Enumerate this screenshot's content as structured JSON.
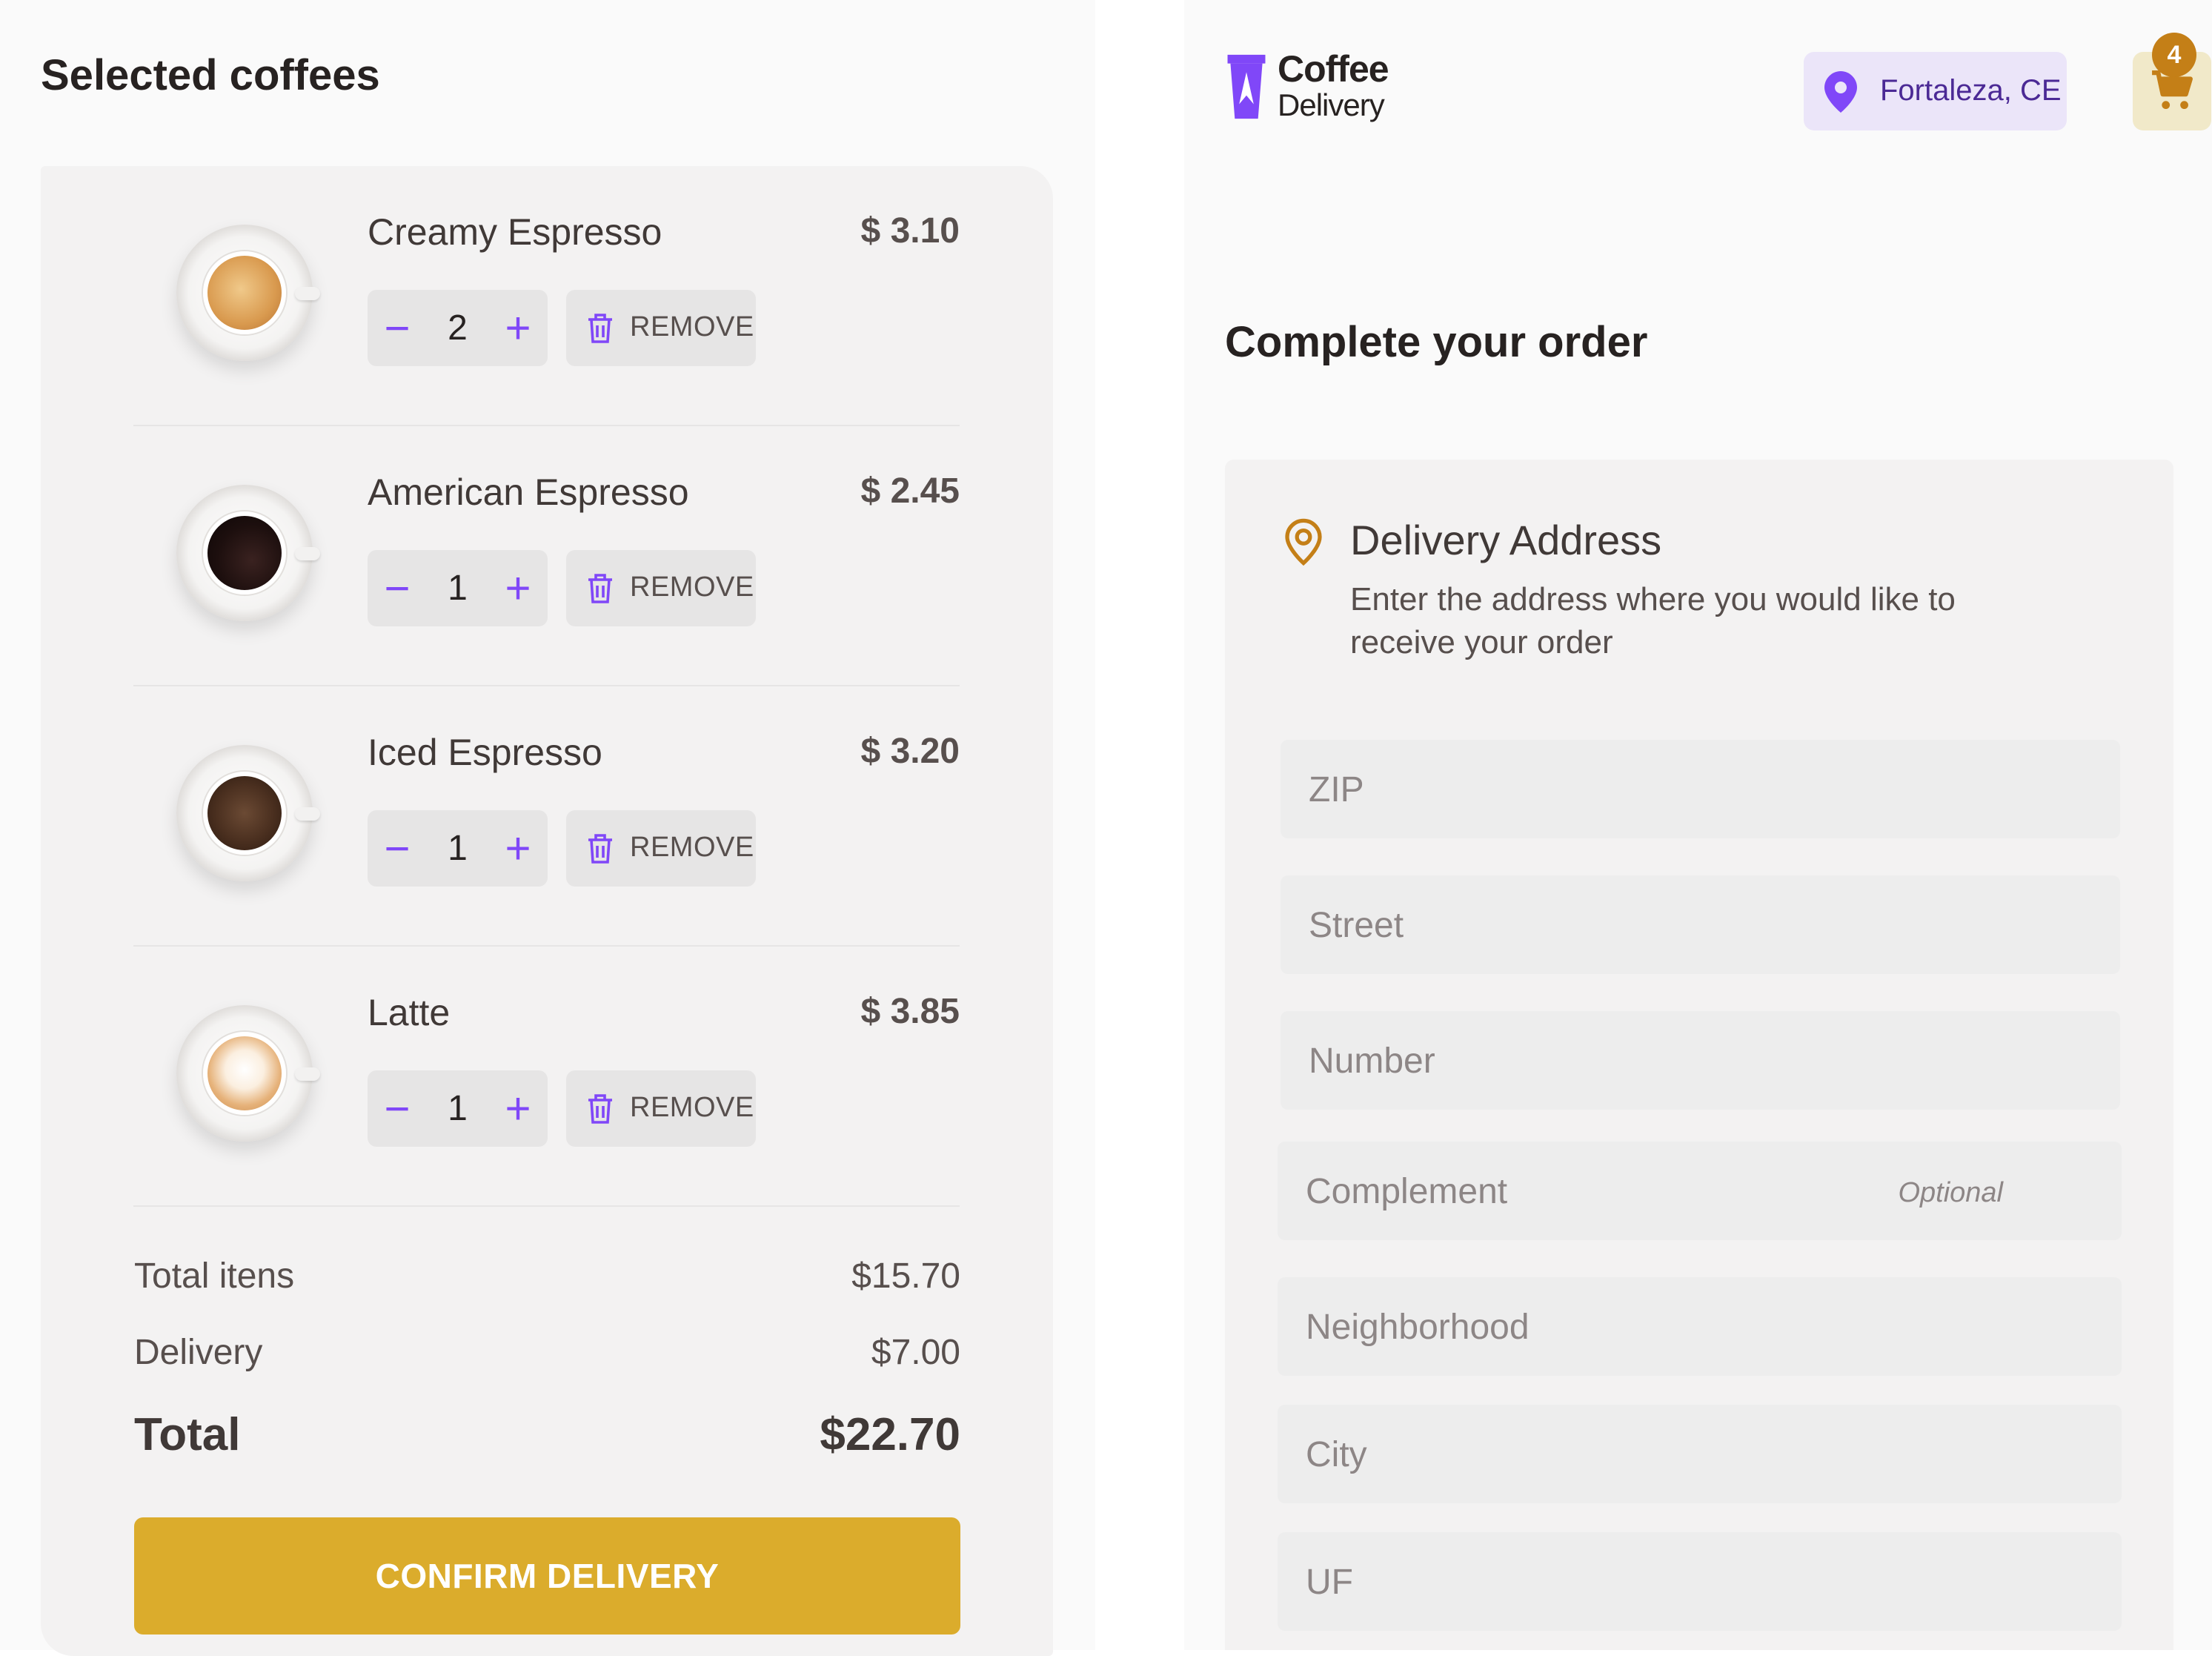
{
  "cart_section": {
    "title": "Selected coffees",
    "items": [
      {
        "name": "Creamy Espresso",
        "price": "$ 3.10",
        "quantity": "2",
        "remove_label": "REMOVE"
      },
      {
        "name": "American Espresso",
        "price": "$ 2.45",
        "quantity": "1",
        "remove_label": "REMOVE"
      },
      {
        "name": "Iced Espresso",
        "price": "$ 3.20",
        "quantity": "1",
        "remove_label": "REMOVE"
      },
      {
        "name": "Latte",
        "price": "$ 3.85",
        "quantity": "1",
        "remove_label": "REMOVE"
      }
    ],
    "summary": {
      "items_label": "Total itens",
      "items_value": "$15.70",
      "delivery_label": "Delivery",
      "delivery_value": "$7.00",
      "total_label": "Total",
      "total_value": "$22.70"
    },
    "confirm_label": "CONFIRM DELIVERY"
  },
  "header": {
    "logo_word1": "Coffee",
    "logo_word2": "Delivery",
    "location": "Fortaleza, CE",
    "cart_count": "4"
  },
  "order_section": {
    "title": "Complete your order",
    "address_title": "Delivery Address",
    "address_subtitle": "Enter the address where you would like to receive your order",
    "fields": {
      "zip": "ZIP",
      "street": "Street",
      "number": "Number",
      "complement": "Complement",
      "complement_hint": "Optional",
      "neighborhood": "Neighborhood",
      "city": "City",
      "uf": "UF"
    }
  },
  "colors": {
    "purple": "#8047f8",
    "purple_dark": "#4b2995",
    "yellow": "#dbac2c",
    "yellow_dark": "#c47f17"
  }
}
